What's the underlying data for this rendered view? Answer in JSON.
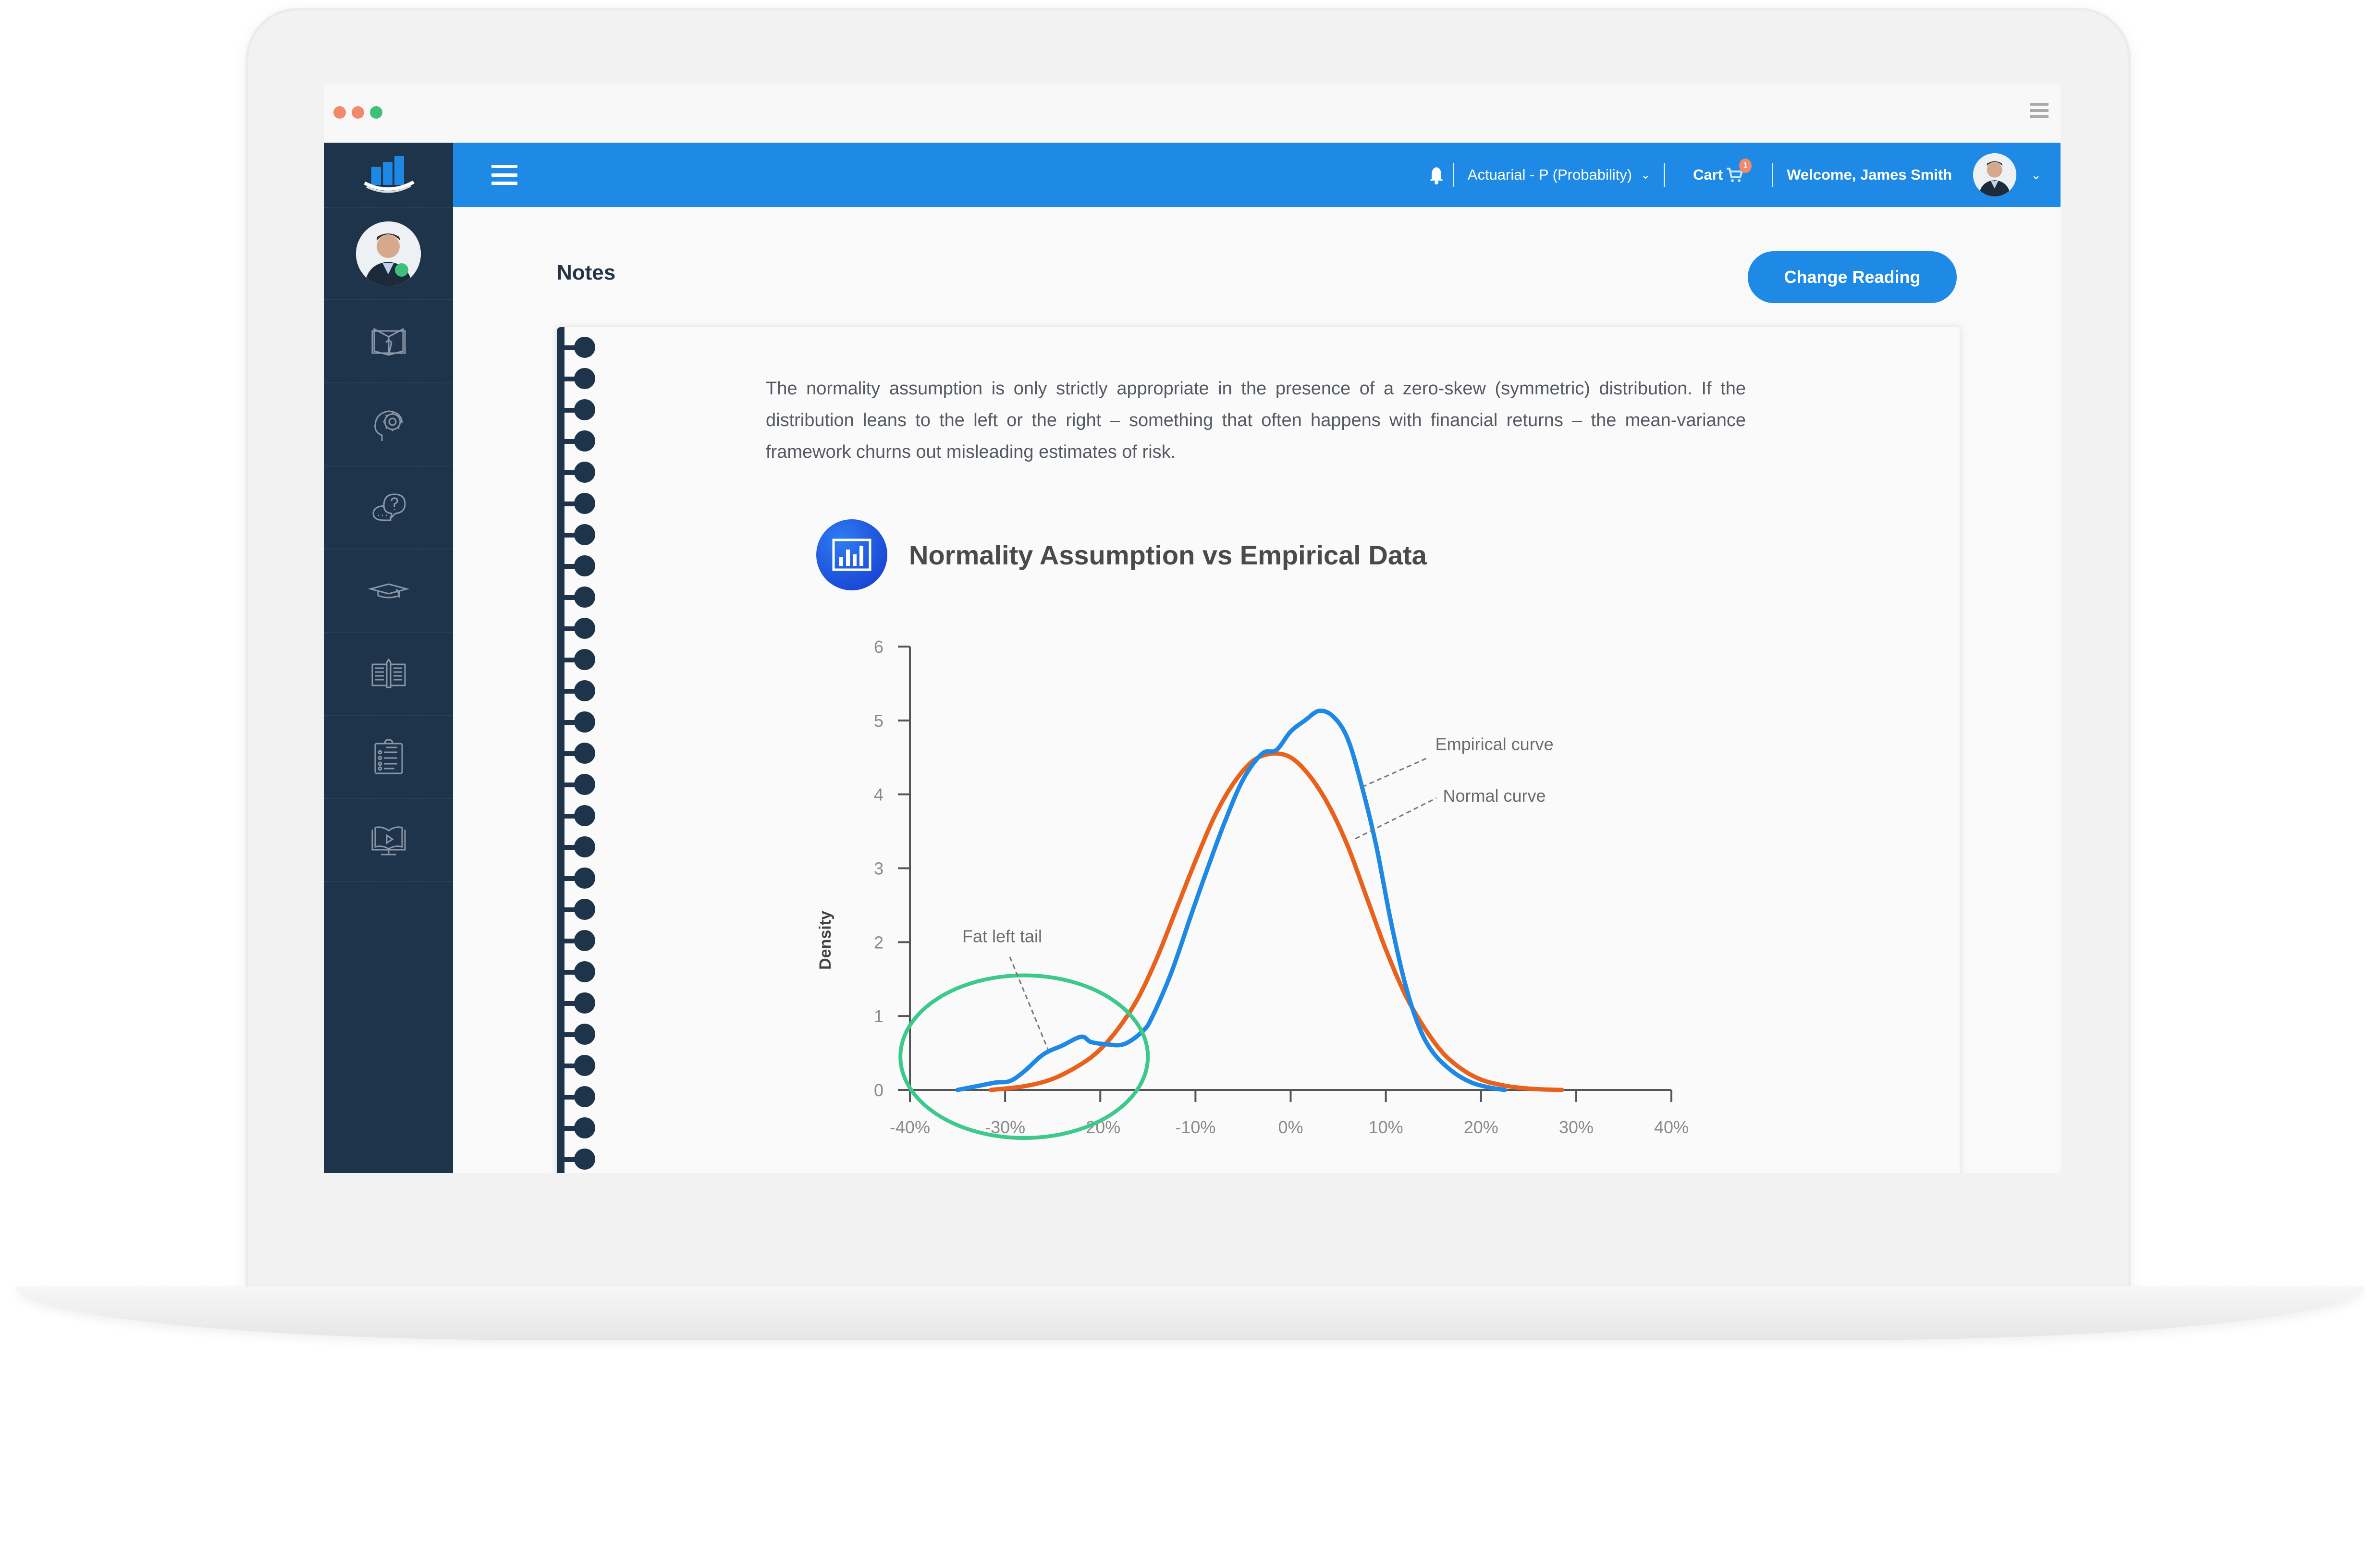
{
  "window": {
    "traffic_lights": [
      "#f08a6a",
      "#f08a6a",
      "#3ec07a"
    ],
    "menu_icon": "hamburger-menu-icon"
  },
  "sidebar": {
    "logo_icon": "bar-chart-logo-icon",
    "user_status": "online",
    "items": [
      {
        "icon": "open-book-icon",
        "label": "Reading"
      },
      {
        "icon": "head-gear-icon",
        "label": "Concepts"
      },
      {
        "icon": "question-chat-icon",
        "label": "Q&A"
      },
      {
        "icon": "graduation-cap-icon",
        "label": "Courses"
      },
      {
        "icon": "book-pencil-icon",
        "label": "Notes"
      },
      {
        "icon": "clipboard-checklist-icon",
        "label": "Tests"
      },
      {
        "icon": "video-book-icon",
        "label": "Video lessons"
      }
    ]
  },
  "topbar": {
    "course_selector": "Actuarial - P (Probability)",
    "cart_label": "Cart",
    "cart_count": "1",
    "welcome_text": "Welcome, James Smith"
  },
  "notes": {
    "title": "Notes",
    "change_button": "Change Reading",
    "paragraph": "The normality assumption is only strictly appropriate in the presence of a zero-skew (symmetric) distribution. If the distribution leans to the left or the right – something that often happens with financial returns – the mean-variance framework churns out misleading estimates of risk."
  },
  "chart_data": {
    "type": "line",
    "title": "Normality Assumption vs Empirical Data",
    "xlabel": "",
    "ylabel": "Density",
    "xlim": [
      -40,
      40
    ],
    "ylim": [
      0,
      6
    ],
    "x_ticks": [
      "-40%",
      "-30%",
      "-20%",
      "-10%",
      "0%",
      "10%",
      "20%",
      "30%",
      "40%"
    ],
    "x_tick_values": [
      -40,
      -30,
      -20,
      -10,
      0,
      10,
      20,
      30,
      40
    ],
    "y_ticks": [
      "0",
      "1",
      "2",
      "3",
      "4",
      "5",
      "6"
    ],
    "y_tick_values": [
      0,
      1,
      2,
      3,
      4,
      5,
      6
    ],
    "grid": false,
    "series": [
      {
        "name": "Normal curve",
        "color": "#e8621d",
        "x": [
          -31.5,
          -28,
          -25,
          -22,
          -20,
          -18,
          -16,
          -14,
          -12,
          -10,
          -8,
          -6,
          -4,
          -2,
          0,
          2,
          4,
          6,
          8,
          10,
          12,
          14,
          16,
          18,
          20,
          22,
          24,
          26,
          28.5
        ],
        "y": [
          0,
          0.05,
          0.15,
          0.35,
          0.55,
          0.85,
          1.25,
          1.8,
          2.45,
          3.1,
          3.7,
          4.15,
          4.45,
          4.55,
          4.5,
          4.25,
          3.85,
          3.3,
          2.6,
          1.9,
          1.3,
          0.85,
          0.5,
          0.28,
          0.14,
          0.07,
          0.03,
          0.01,
          0
        ]
      },
      {
        "name": "Empirical curve",
        "color": "#1e88e5",
        "x": [
          -35,
          -33,
          -31,
          -29.5,
          -28,
          -26,
          -24,
          -22,
          -21,
          -19.5,
          -17.5,
          -15.5,
          -14.5,
          -12.5,
          -10.5,
          -9,
          -7,
          -5,
          -3,
          -1.5,
          0,
          1.5,
          3,
          4.5,
          6,
          7.5,
          9,
          10.5,
          12,
          13.5,
          15,
          17,
          19,
          21,
          22.5
        ],
        "y": [
          0,
          0.05,
          0.1,
          0.12,
          0.25,
          0.48,
          0.6,
          0.72,
          0.65,
          0.62,
          0.62,
          0.8,
          1.0,
          1.6,
          2.35,
          2.9,
          3.6,
          4.2,
          4.55,
          4.6,
          4.85,
          5.0,
          5.13,
          5.05,
          4.75,
          4.1,
          3.3,
          2.3,
          1.45,
          0.85,
          0.5,
          0.25,
          0.1,
          0.03,
          0
        ]
      }
    ],
    "annotations": [
      {
        "text": "Empirical curve",
        "target_series": "Empirical curve",
        "x": 13,
        "y": 4.9
      },
      {
        "text": "Normal curve",
        "target_series": "Normal curve",
        "x": 13.5,
        "y": 4.2
      },
      {
        "text": "Fat left tail",
        "x": -29,
        "y": 2.0,
        "target": "left tail region"
      }
    ],
    "highlight_ellipse": {
      "label": "Fat left tail",
      "color": "#3cc98a",
      "x_center": -28,
      "y_center": 0.45,
      "x_radius": 13,
      "y_radius": 1.1
    }
  }
}
